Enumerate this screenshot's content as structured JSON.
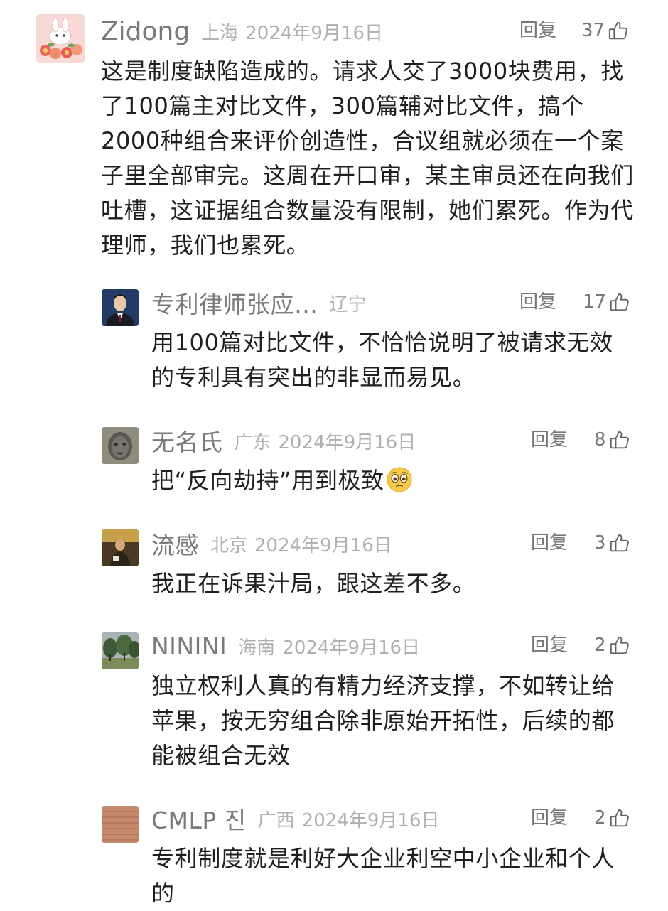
{
  "reply_label": "回复",
  "comments": [
    {
      "user": "Zidong",
      "location": "上海",
      "date": "2024年9月16日",
      "likes": "37",
      "text": "这是制度缺陷造成的。请求人交了3000块费用，找了100篇主对比文件，300篇辅对比文件，搞个2000种组合来评价创造性，合议组就必须在一个案子里全部审完。这周在开口审，某主审员还在向我们吐槽，这证据组合数量没有限制，她们累死。作为代理师，我们也累死。",
      "avatar": "cartoon-rabbit-flowers-avatar"
    },
    {
      "user": "专利律师张应…",
      "location": "辽宁",
      "date": "",
      "likes": "17",
      "text": "用100篇对比文件，不恰恰说明了被请求无效的专利具有突出的非显而易见。",
      "avatar": "man-in-suit-avatar"
    },
    {
      "user": "无名氏",
      "location": "广东",
      "date": "2024年9月16日",
      "likes": "8",
      "text": "把“反向劫持”用到极致",
      "emoji": "pleading-face-emoji",
      "avatar": "stone-face-sculpture-avatar"
    },
    {
      "user": "流感",
      "location": "北京",
      "date": "2024年9月16日",
      "likes": "3",
      "text": "我正在诉果汁局，跟这差不多。",
      "avatar": "person-photo-avatar"
    },
    {
      "user": "NININI",
      "location": "海南",
      "date": "2024年9月16日",
      "likes": "2",
      "text": "独立权利人真的有精力经济支撑，不如转让给苹果，按无穷组合除非原始开拓性，后续的都能被组合无效",
      "avatar": "trees-landscape-avatar"
    },
    {
      "user": "CMLP 진",
      "location": "广西",
      "date": "2024年9月16日",
      "likes": "2",
      "text": "专利制度就是利好大企业利空中小企业和个人的",
      "avatar": "brick-texture-avatar"
    }
  ]
}
